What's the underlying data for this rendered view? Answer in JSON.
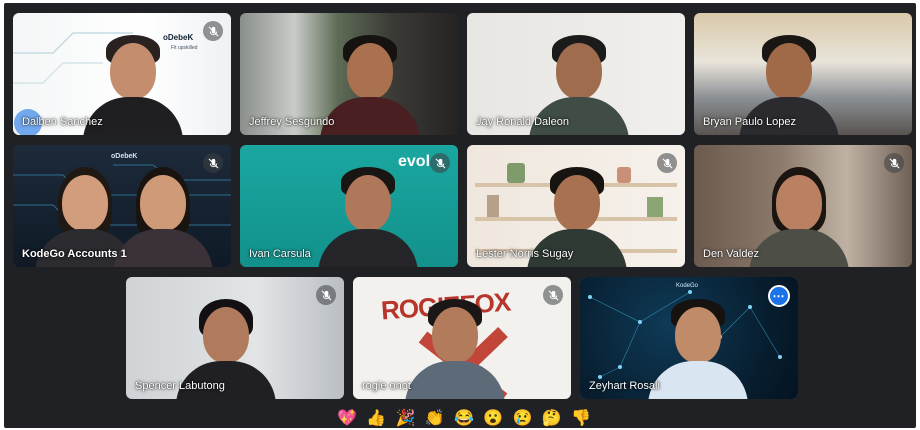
{
  "participants": [
    {
      "name": "Dalben Sanchez",
      "muted": true
    },
    {
      "name": "Jeffrey Sesgundo",
      "muted": false
    },
    {
      "name": "Jay Ronald Daleon",
      "muted": false
    },
    {
      "name": "Bryan Paulo Lopez",
      "muted": false
    },
    {
      "name": "KodeGo Accounts 1",
      "muted": true
    },
    {
      "name": "Ivan Carsula",
      "muted": true
    },
    {
      "name": "Lester Norris Sugay",
      "muted": true
    },
    {
      "name": "Den Valdez",
      "muted": true
    },
    {
      "name": "Spencer Labutong",
      "muted": true
    },
    {
      "name": "rogie onot",
      "muted": true
    },
    {
      "name": "Zeyhart Rosali",
      "muted": false
    }
  ],
  "backgrounds": {
    "tile1_logo": "oDebeK",
    "tile1_tagline": "Fit upskilled",
    "tile5_logo": "oDebeK",
    "tile6_logo": "evol",
    "tile10_text": "ROGIEFOX",
    "tile11_text": "KodeGo"
  },
  "reactions": [
    "💖",
    "👍",
    "🎉",
    "👏",
    "😂",
    "😮",
    "😢",
    "🤔",
    "👎"
  ],
  "colors": {
    "stage": "#202124",
    "active_border": "#8ab4f8",
    "more_button": "#1a73e8"
  }
}
